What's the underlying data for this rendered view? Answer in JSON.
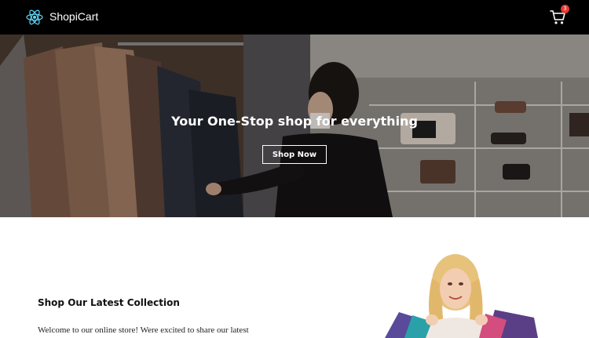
{
  "navbar": {
    "brand": "ShopiCart",
    "logo_icon": "react-atom-icon",
    "cart_icon": "shopping-cart-icon",
    "cart_count": "3",
    "accent_color": "#61dafb",
    "badge_color": "#e53935"
  },
  "hero": {
    "title": "Your One-Stop shop for everything",
    "button_label": "Shop Now"
  },
  "collection": {
    "title": "Shop Our Latest Collection",
    "text": "Welcome to our online store! Were excited to share our latest"
  }
}
